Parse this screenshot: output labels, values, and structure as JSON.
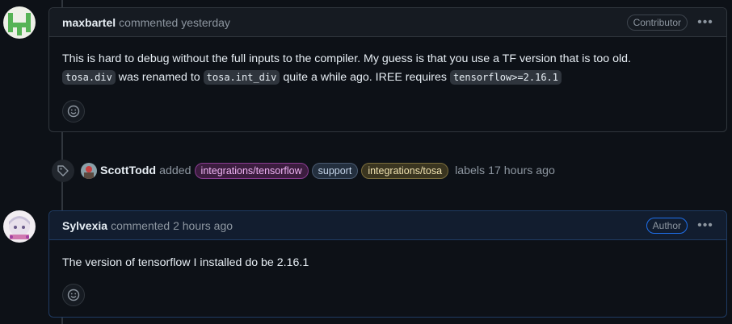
{
  "comment1": {
    "author": "maxbartel",
    "meta": "commented yesterday",
    "role": "Contributor",
    "body": {
      "line1": "This is hard to debug without the full inputs to the compiler. My guess is that you use a TF version that is too old.",
      "code1": "tosa.div",
      "text2": "was renamed to",
      "code2": "tosa.int_div",
      "text3": "quite a while ago. IREE requires",
      "code3": "tensorflow>=2.16.1"
    }
  },
  "event": {
    "actor": "ScottTodd",
    "action": "added",
    "labels": [
      {
        "name": "integrations/tensorflow",
        "bg": "#3c1d3f",
        "border": "#8a3c92",
        "color": "#f0b5f5"
      },
      {
        "name": "support",
        "bg": "#232f3e",
        "border": "#4a5a70",
        "color": "#c5d5ea"
      },
      {
        "name": "integrations/tosa",
        "bg": "#3a3520",
        "border": "#7a6d3c",
        "color": "#f0e2b0"
      }
    ],
    "suffix": "labels 17 hours ago"
  },
  "comment2": {
    "author": "Sylvexia",
    "meta": "commented 2 hours ago",
    "role": "Author",
    "body": "The version of tensorflow I installed do be 2.16.1"
  },
  "icons": {
    "menu": "kebab-horizontal-icon",
    "reaction": "smiley-icon",
    "tag": "tag-icon"
  }
}
